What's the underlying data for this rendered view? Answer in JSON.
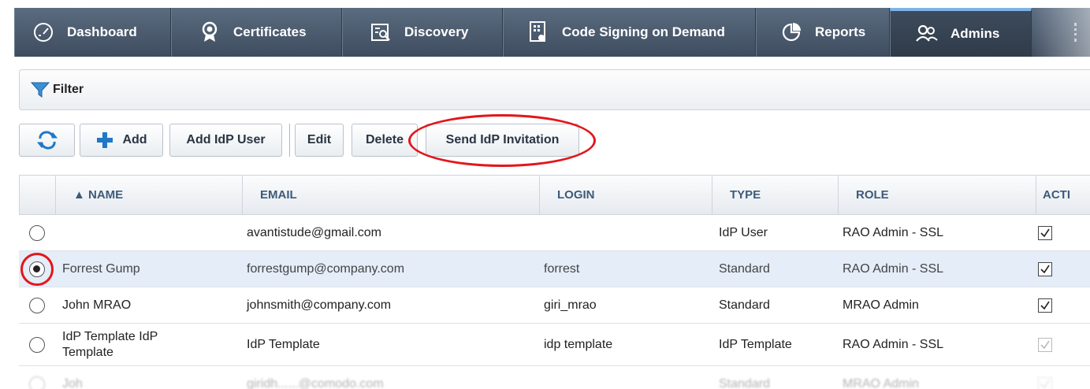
{
  "nav": {
    "items": [
      {
        "label": "Dashboard",
        "icon": "gauge-icon",
        "active": false
      },
      {
        "label": "Certificates",
        "icon": "certificate-icon",
        "active": false
      },
      {
        "label": "Discovery",
        "icon": "discovery-icon",
        "active": false
      },
      {
        "label": "Code Signing on Demand",
        "icon": "code-signing-icon",
        "active": false
      },
      {
        "label": "Reports",
        "icon": "reports-icon",
        "active": false
      },
      {
        "label": "Admins",
        "icon": "admins-icon",
        "active": true
      }
    ]
  },
  "filter": {
    "label": "Filter"
  },
  "toolbar": {
    "refresh_icon": "refresh-icon",
    "add_label": "Add",
    "add_idp_user_label": "Add IdP User",
    "edit_label": "Edit",
    "delete_label": "Delete",
    "send_idp_invitation_label": "Send IdP Invitation"
  },
  "table": {
    "columns": [
      "▲ NAME",
      "EMAIL",
      "LOGIN",
      "TYPE",
      "ROLE",
      "ACTI"
    ],
    "rows": [
      {
        "name": "",
        "email": "avantistude@gmail.com",
        "login": "",
        "type": "IdP User",
        "role": "RAO Admin - SSL",
        "active": true,
        "selected": false
      },
      {
        "name": "Forrest Gump",
        "email": "forrestgump@company.com",
        "login": "forrest",
        "type": "Standard",
        "role": "RAO Admin - SSL",
        "active": true,
        "selected": true
      },
      {
        "name": "John MRAO",
        "email": "johnsmith@company.com",
        "login": "giri_mrao",
        "type": "Standard",
        "role": "MRAO Admin",
        "active": true,
        "selected": false
      },
      {
        "name_line1": "IdP Template IdP",
        "name_line2": "Template",
        "email": "IdP Template",
        "login": "idp template",
        "type": "IdP Template",
        "role": "RAO Admin - SSL",
        "active": true,
        "selected": false
      },
      {
        "name": "Joh",
        "email": "giridh......@comodo.com",
        "login": "",
        "type": "Standard",
        "role": "MRAO Admin",
        "active": true,
        "selected": false
      }
    ]
  },
  "colors": {
    "nav_bg": "#4a596b",
    "accent_red": "#e3161b",
    "header_text": "#3d5a7a",
    "selected_row": "#e4edf8",
    "add_icon": "#1f78c8"
  }
}
